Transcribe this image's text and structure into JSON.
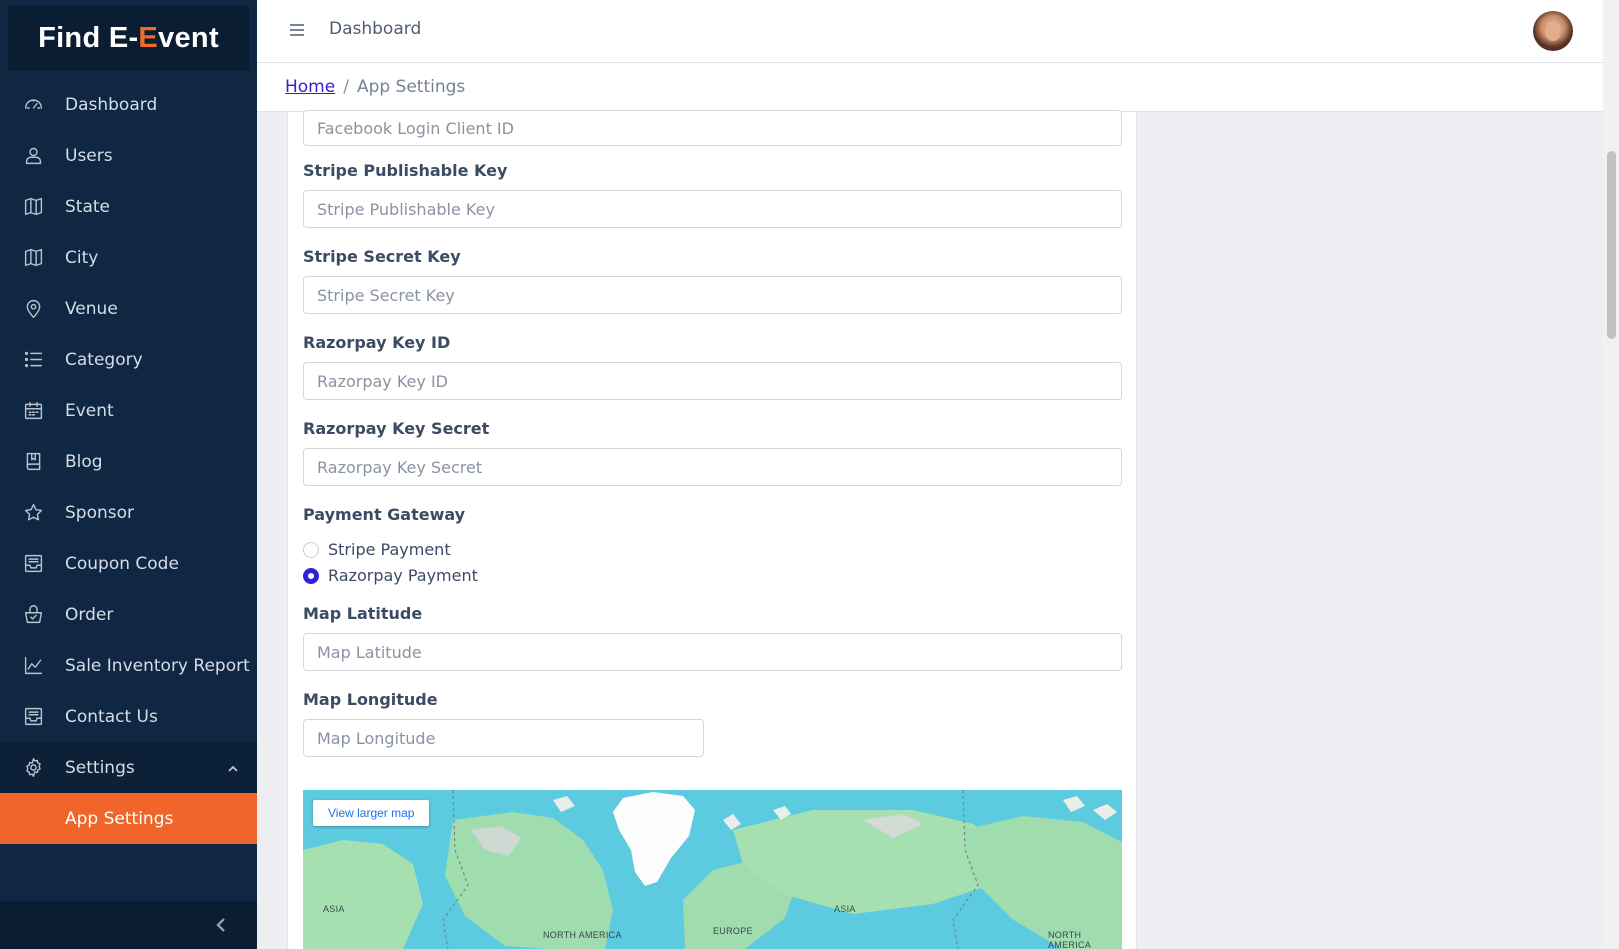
{
  "brand": {
    "part1": "Find E-",
    "accent": "E",
    "part2": "vent"
  },
  "sidebar": {
    "items": [
      {
        "label": "Dashboard",
        "icon": "speedometer-icon"
      },
      {
        "label": "Users",
        "icon": "user-icon"
      },
      {
        "label": "State",
        "icon": "map-icon"
      },
      {
        "label": "City",
        "icon": "map-icon"
      },
      {
        "label": "Venue",
        "icon": "location-pin-icon"
      },
      {
        "label": "Category",
        "icon": "list-icon"
      },
      {
        "label": "Event",
        "icon": "calendar-icon"
      },
      {
        "label": "Blog",
        "icon": "book-icon"
      },
      {
        "label": "Sponsor",
        "icon": "star-icon"
      },
      {
        "label": "Coupon Code",
        "icon": "inbox-icon"
      },
      {
        "label": "Order",
        "icon": "basket-icon"
      },
      {
        "label": "Sale Inventory Report",
        "icon": "chart-line-icon"
      },
      {
        "label": "Contact Us",
        "icon": "inbox-icon"
      }
    ],
    "settings_label": "Settings",
    "active_sub_label": "App Settings"
  },
  "header": {
    "title": "Dashboard"
  },
  "breadcrumb": {
    "home": "Home",
    "current": "App Settings"
  },
  "form": {
    "facebook_client_id_placeholder": "Facebook Login Client ID",
    "stripe_pub_label": "Stripe Publishable Key",
    "stripe_pub_placeholder": "Stripe Publishable Key",
    "stripe_secret_label": "Stripe Secret Key",
    "stripe_secret_placeholder": "Stripe Secret Key",
    "razorpay_id_label": "Razorpay Key ID",
    "razorpay_id_placeholder": "Razorpay Key ID",
    "razorpay_secret_label": "Razorpay Key Secret",
    "razorpay_secret_placeholder": "Razorpay Key Secret",
    "payment_gateway_label": "Payment Gateway",
    "gateway_options": [
      {
        "label": "Stripe Payment",
        "selected": false
      },
      {
        "label": "Razorpay Payment",
        "selected": true
      }
    ],
    "map_lat_label": "Map Latitude",
    "map_lat_placeholder": "Map Latitude",
    "map_lng_label": "Map Longitude",
    "map_lng_placeholder": "Map Longitude"
  },
  "map": {
    "view_larger": "View larger map",
    "labels": [
      "ASIA",
      "NORTH AMERICA",
      "EUROPE",
      "ASIA",
      "NORTH AMERICA"
    ]
  },
  "colors": {
    "sidebar_bg": "#0f2742",
    "accent": "#f0652a",
    "link": "#321fdb",
    "ocean": "#5ccbe0"
  }
}
